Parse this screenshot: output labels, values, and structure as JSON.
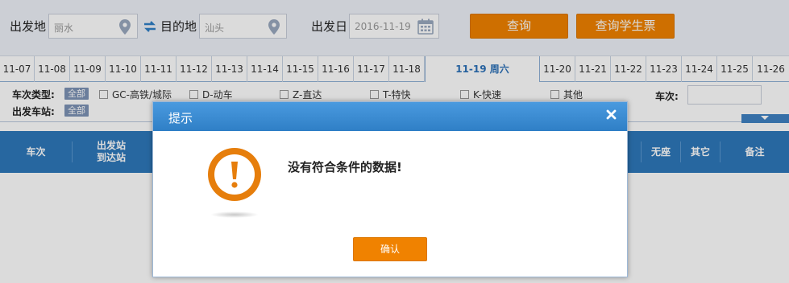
{
  "search": {
    "from_label": "出发地",
    "from_value": "丽水",
    "to_label": "目的地",
    "to_value": "汕头",
    "date_label": "出发日",
    "date_value": "2016-11-19",
    "query_button": "查询",
    "student_query_button": "查询学生票"
  },
  "dates": [
    "11-07",
    "11-08",
    "11-09",
    "11-10",
    "11-11",
    "11-12",
    "11-13",
    "11-14",
    "11-15",
    "11-16",
    "11-17",
    "11-18",
    "11-19 周六",
    "11-20",
    "11-21",
    "11-22",
    "11-23",
    "11-24",
    "11-25",
    "11-26"
  ],
  "filters": {
    "train_type_label": "车次类型:",
    "station_label": "出发车站:",
    "all_label": "全部",
    "options": [
      "GC-高铁/城际",
      "D-动车",
      "Z-直达",
      "T-特快",
      "K-快速",
      "其他"
    ],
    "train_no_label": "车次:"
  },
  "table_header": {
    "train": "车次",
    "station_from": "出发站",
    "station_to": "到达站",
    "no_seat": "无座",
    "other": "其它",
    "remarks": "备注"
  },
  "dialog": {
    "title": "提示",
    "message": "没有符合条件的数据!",
    "ok_button": "确认"
  },
  "colors": {
    "accent_orange": "#f08200",
    "header_blue": "#2e78bb",
    "dialog_blue": "#3b8ad2"
  }
}
